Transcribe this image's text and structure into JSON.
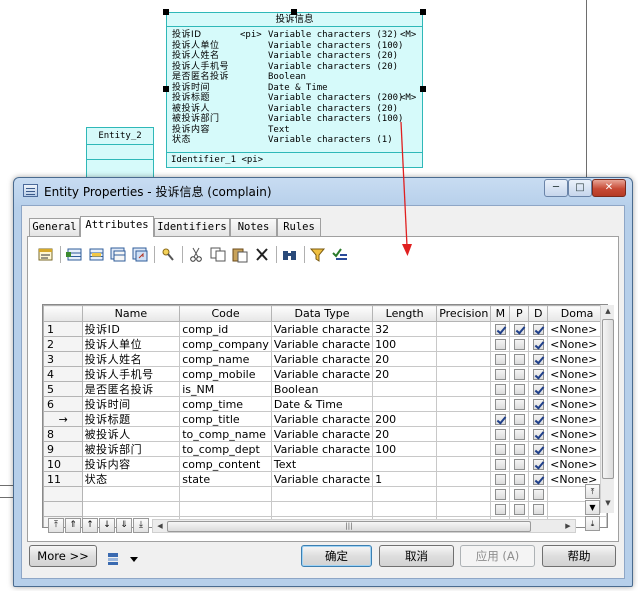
{
  "diagram": {
    "main_entity": {
      "title": "投诉信息",
      "attributes": [
        {
          "name": "投诉ID",
          "pi": "<pi>",
          "type": "Variable characters (32)",
          "mandatory": "<M>"
        },
        {
          "name": "投诉人单位",
          "pi": "",
          "type": "Variable characters (100)",
          "mandatory": ""
        },
        {
          "name": "投诉人姓名",
          "pi": "",
          "type": "Variable characters (20)",
          "mandatory": ""
        },
        {
          "name": "投诉人手机号",
          "pi": "",
          "type": "Variable characters (20)",
          "mandatory": ""
        },
        {
          "name": "是否匿名投诉",
          "pi": "",
          "type": "Boolean",
          "mandatory": ""
        },
        {
          "name": "投诉时间",
          "pi": "",
          "type": "Date & Time",
          "mandatory": ""
        },
        {
          "name": "投诉标题",
          "pi": "",
          "type": "Variable characters (200)",
          "mandatory": "<M>"
        },
        {
          "name": "被投诉人",
          "pi": "",
          "type": "Variable characters (20)",
          "mandatory": ""
        },
        {
          "name": "被投诉部门",
          "pi": "",
          "type": "Variable characters (100)",
          "mandatory": ""
        },
        {
          "name": "投诉内容",
          "pi": "",
          "type": "Text",
          "mandatory": ""
        },
        {
          "name": "状态",
          "pi": "",
          "type": "Variable characters (1)",
          "mandatory": ""
        }
      ],
      "identifier": "Identifier_1  <pi>"
    },
    "small_entity": {
      "title": "Entity_2"
    }
  },
  "dialog": {
    "title": "Entity Properties - 投诉信息 (complain)",
    "tabs": [
      "General",
      "Attributes",
      "Identifiers",
      "Notes",
      "Rules"
    ],
    "active_tab": "Attributes",
    "toolbar_icons": [
      "properties-icon",
      "add-row-icon",
      "insert-row-icon",
      "add-attributes-icon",
      "reuse-icon",
      "find-icon",
      "cut-icon",
      "copy-icon",
      "paste-icon",
      "delete-icon",
      "binoculars-icon",
      "filter-icon",
      "check-filter-icon"
    ],
    "grid": {
      "columns": [
        "",
        "Name",
        "Code",
        "Data Type",
        "Length",
        "Precision",
        "M",
        "P",
        "D",
        "Doma"
      ],
      "rows": [
        {
          "num": "1",
          "name": "投诉ID",
          "code": "comp_id",
          "type": "Variable characte",
          "length": "32",
          "m": true,
          "p": true,
          "d": true,
          "domain": "<None>"
        },
        {
          "num": "2",
          "name": "投诉人单位",
          "code": "comp_company",
          "type": "Variable characte",
          "length": "100",
          "m": false,
          "p": false,
          "d": true,
          "domain": "<None>"
        },
        {
          "num": "3",
          "name": "投诉人姓名",
          "code": "comp_name",
          "type": "Variable characte",
          "length": "20",
          "m": false,
          "p": false,
          "d": true,
          "domain": "<None>"
        },
        {
          "num": "4",
          "name": "投诉人手机号",
          "code": "comp_mobile",
          "type": "Variable characte",
          "length": "20",
          "m": false,
          "p": false,
          "d": true,
          "domain": "<None>"
        },
        {
          "num": "5",
          "name": "是否匿名投诉",
          "code": "is_NM",
          "type": "Boolean",
          "length": "",
          "m": false,
          "p": false,
          "d": true,
          "domain": "<None>"
        },
        {
          "num": "6",
          "name": "投诉时间",
          "code": "comp_time",
          "type": "Date & Time",
          "length": "",
          "m": false,
          "p": false,
          "d": true,
          "domain": "<None>"
        },
        {
          "num": "→",
          "name": "投诉标题",
          "code": "comp_title",
          "type": "Variable characte",
          "length": "200",
          "m": true,
          "p": false,
          "d": true,
          "domain": "<None>"
        },
        {
          "num": "8",
          "name": "被投诉人",
          "code": "to_comp_name",
          "type": "Variable characte",
          "length": "20",
          "m": false,
          "p": false,
          "d": true,
          "domain": "<None>"
        },
        {
          "num": "9",
          "name": "被投诉部门",
          "code": "to_comp_dept",
          "type": "Variable characte",
          "length": "100",
          "m": false,
          "p": false,
          "d": true,
          "domain": "<None>"
        },
        {
          "num": "10",
          "name": "投诉内容",
          "code": "comp_content",
          "type": "Text",
          "length": "",
          "m": false,
          "p": false,
          "d": true,
          "domain": "<None>"
        },
        {
          "num": "11",
          "name": "状态",
          "code": "state",
          "type": "Variable characte",
          "length": "1",
          "m": false,
          "p": false,
          "d": true,
          "domain": "<None>"
        }
      ],
      "empty_rows": 5
    },
    "buttons": {
      "more": "More >>",
      "ok": "确定",
      "cancel": "取消",
      "apply": "应用 (A)",
      "help": "帮助"
    }
  }
}
